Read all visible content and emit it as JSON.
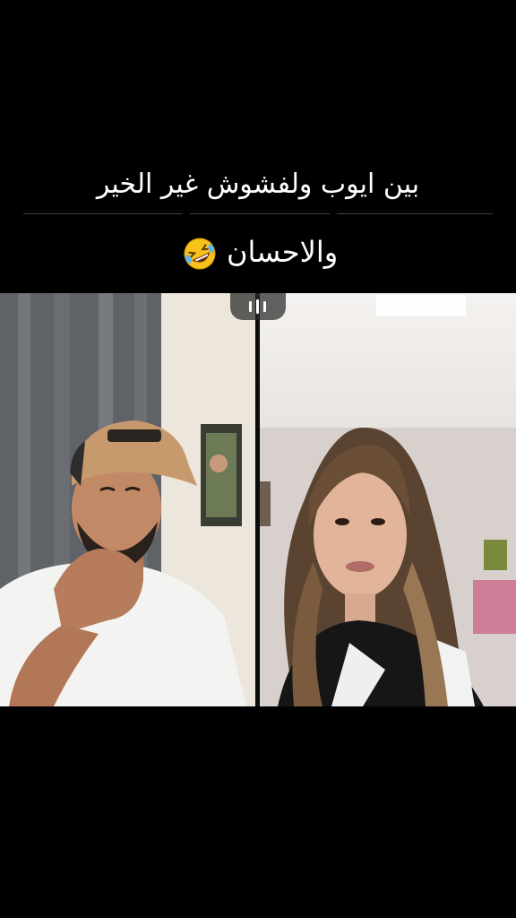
{
  "caption": {
    "line1": "بين ايوب ولفشوش غير الخير",
    "line2": "والاحسان",
    "emoji": "rolling-on-floor-laughing-emoji"
  },
  "video": {
    "left_participant": "man-in-cap",
    "right_participant": "woman-long-hair",
    "handle_icon": "drag-handle-icon"
  },
  "colors": {
    "background": "#000000",
    "caption_text": "#ffffff"
  }
}
